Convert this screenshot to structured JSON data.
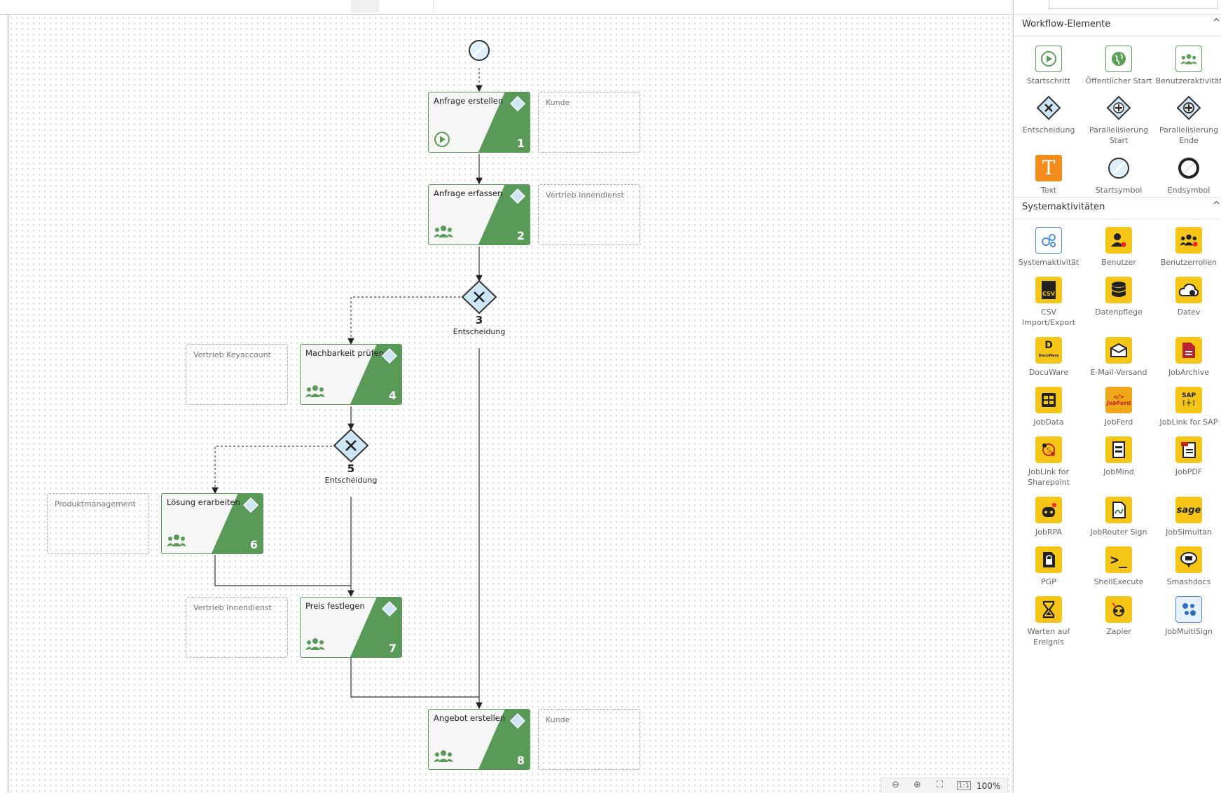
{
  "zoom": {
    "level": "100%"
  },
  "panel": {
    "workflow_section": {
      "title": "Workflow-Elemente",
      "items": [
        {
          "label": "Startschritt",
          "icon": "play-circle-icon"
        },
        {
          "label": "Öffentlicher Start",
          "icon": "globe-icon"
        },
        {
          "label": "Benutzeraktivität",
          "icon": "users-icon"
        },
        {
          "label": "Entscheidung",
          "icon": "decision-gateway-icon"
        },
        {
          "label": "Parallelisierung Start",
          "icon": "parallel-start-icon"
        },
        {
          "label": "Parallelisierung Ende",
          "icon": "parallel-end-icon"
        },
        {
          "label": "Text",
          "icon": "text-icon"
        },
        {
          "label": "Startsymbol",
          "icon": "start-symbol-icon"
        },
        {
          "label": "Endsymbol",
          "icon": "end-symbol-icon"
        }
      ]
    },
    "system_section": {
      "title": "Systemaktivitäten",
      "items": [
        {
          "label": "Systemaktivität",
          "icon": "gears-icon"
        },
        {
          "label": "Benutzer",
          "icon": "user-gear-icon"
        },
        {
          "label": "Benutzerrollen",
          "icon": "users-gear-icon"
        },
        {
          "label": "CSV Import/Export",
          "icon": "csv-file-icon"
        },
        {
          "label": "Datenpflege",
          "icon": "database-icon"
        },
        {
          "label": "Datev",
          "icon": "cloud-sync-icon"
        },
        {
          "label": "DocuWare",
          "icon": "docuware-icon"
        },
        {
          "label": "E-Mail-Versand",
          "icon": "mail-icon"
        },
        {
          "label": "JobArchive",
          "icon": "archive-file-icon"
        },
        {
          "label": "JobData",
          "icon": "table-icon"
        },
        {
          "label": "JobFerd",
          "icon": "jobferd-icon"
        },
        {
          "label": "JobLink for SAP",
          "icon": "sap-link-icon"
        },
        {
          "label": "JobLink for Sharepoint",
          "icon": "sharepoint-link-icon"
        },
        {
          "label": "JobMind",
          "icon": "jobmind-icon"
        },
        {
          "label": "JobPDF",
          "icon": "pdf-icon"
        },
        {
          "label": "JobRPA",
          "icon": "robot-icon"
        },
        {
          "label": "JobRouter Sign",
          "icon": "sign-icon"
        },
        {
          "label": "JobSimultan",
          "icon": "sage-icon"
        },
        {
          "label": "PGP",
          "icon": "lock-file-icon"
        },
        {
          "label": "ShellExecute",
          "icon": "terminal-icon"
        },
        {
          "label": "Smashdocs",
          "icon": "smashdocs-icon"
        },
        {
          "label": "Warten auf Ereignis",
          "icon": "hourglass-icon"
        },
        {
          "label": "Zapier",
          "icon": "zapier-icon"
        },
        {
          "label": "JobMultiSign",
          "icon": "multisign-icon"
        }
      ]
    }
  },
  "workflow": {
    "activities": [
      {
        "title": "Anfrage erstellen",
        "number": "1",
        "icon": "play-circle-icon",
        "lane": "Kunde"
      },
      {
        "title": "Anfrage erfassen",
        "number": "2",
        "icon": "users-icon",
        "lane": "Vertrieb Innendienst"
      },
      {
        "title": "Machbarkeit prüfen",
        "number": "4",
        "icon": "users-icon",
        "lane": "Vertrieb Keyaccount"
      },
      {
        "title": "Lösung erarbeiten",
        "number": "6",
        "icon": "users-icon",
        "lane": "Produktmanagement"
      },
      {
        "title": "Preis festlegen",
        "number": "7",
        "icon": "users-icon",
        "lane": "Vertrieb Innendienst"
      },
      {
        "title": "Angebot erstellen",
        "number": "8",
        "icon": "users-icon",
        "lane": "Kunde"
      }
    ],
    "gateways": [
      {
        "number": "3",
        "label": "Entscheidung"
      },
      {
        "number": "5",
        "label": "Entscheidung"
      }
    ]
  },
  "colors": {
    "activity_green": "#5a9a58",
    "gateway_blue": "#cfe6f7",
    "toolbar_yellow": "#f5c518"
  }
}
